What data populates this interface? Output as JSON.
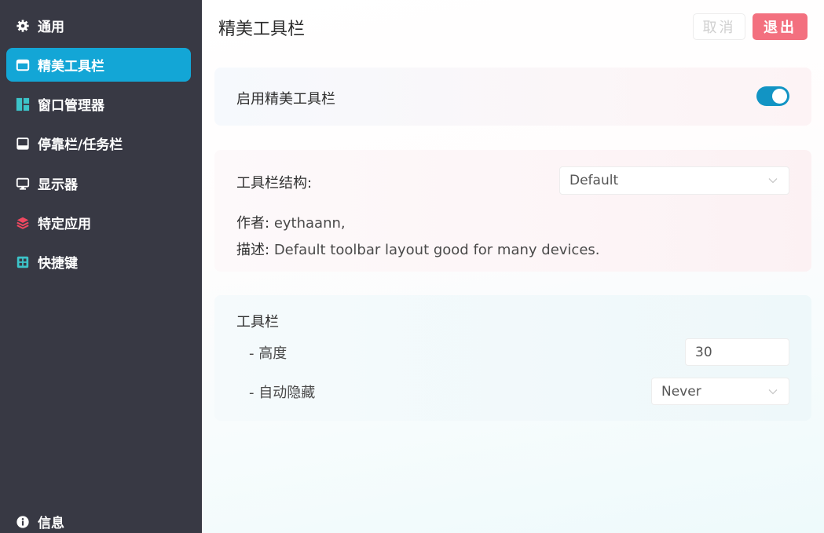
{
  "sidebar": {
    "items": [
      {
        "label": "通用",
        "icon": "gear-icon"
      },
      {
        "label": "精美工具栏",
        "icon": "window-icon",
        "active": true
      },
      {
        "label": "窗口管理器",
        "icon": "tiles-icon"
      },
      {
        "label": "停靠栏/任务栏",
        "icon": "dock-icon"
      },
      {
        "label": "显示器",
        "icon": "monitor-icon"
      },
      {
        "label": "特定应用",
        "icon": "layers-icon"
      },
      {
        "label": "快捷键",
        "icon": "keyboard-icon"
      }
    ],
    "footer": {
      "label": "信息",
      "icon": "info-icon"
    }
  },
  "header": {
    "title": "精美工具栏",
    "cancel_label": "取消",
    "exit_label": "退出"
  },
  "enable_card": {
    "label": "启用精美工具栏",
    "enabled": true
  },
  "structure_card": {
    "label": "工具栏结构:",
    "selected": "Default",
    "author_label": "作者:",
    "author_value": "eythaann,",
    "desc_label": "描述:",
    "desc_value": "Default toolbar layout good for many devices."
  },
  "toolbar_card": {
    "title": "工具栏",
    "height_label": "- 高度",
    "height_value": "30",
    "autohide_label": "- 自动隐藏",
    "autohide_value": "Never"
  },
  "colors": {
    "sidebar_bg": "#383944",
    "accent": "#13a6d6",
    "exit_button": "#f3707f"
  }
}
